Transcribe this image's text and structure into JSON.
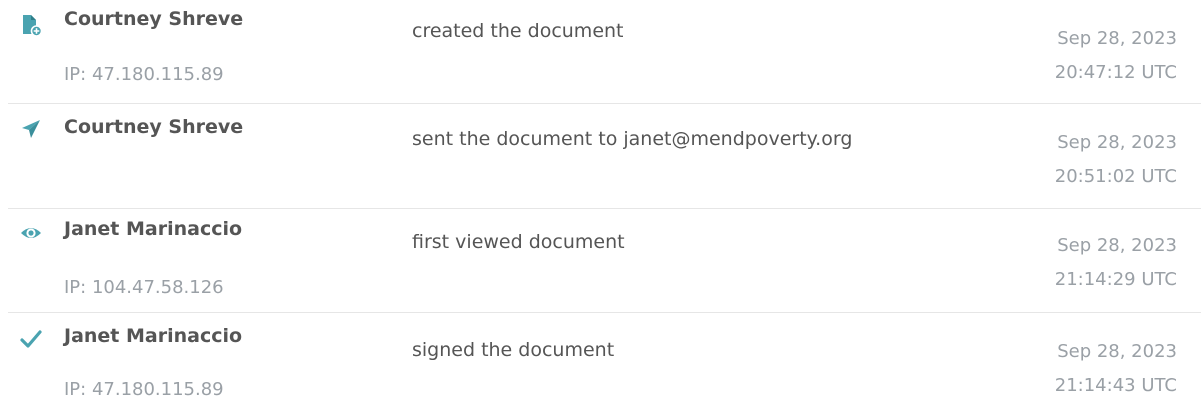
{
  "audit_trail": {
    "icon_color": "#4aa3b0",
    "events": [
      {
        "icon": "document-add-icon",
        "actor": "Courtney Shreve",
        "ip": "IP: 47.180.115.89",
        "action": "created the document",
        "date": "Sep 28, 2023",
        "time": "20:47:12 UTC"
      },
      {
        "icon": "paper-plane-icon",
        "actor": "Courtney Shreve",
        "ip": "",
        "action": "sent the document to janet@mendpoverty.org",
        "date": "Sep 28, 2023",
        "time": "20:51:02 UTC"
      },
      {
        "icon": "eye-icon",
        "actor": "Janet Marinaccio",
        "ip": "IP: 104.47.58.126",
        "action": "first viewed document",
        "date": "Sep 28, 2023",
        "time": "21:14:29 UTC"
      },
      {
        "icon": "checkmark-icon",
        "actor": "Janet Marinaccio",
        "ip": "IP: 47.180.115.89",
        "action": "signed the document",
        "date": "Sep 28, 2023",
        "time": "21:14:43 UTC"
      }
    ]
  }
}
